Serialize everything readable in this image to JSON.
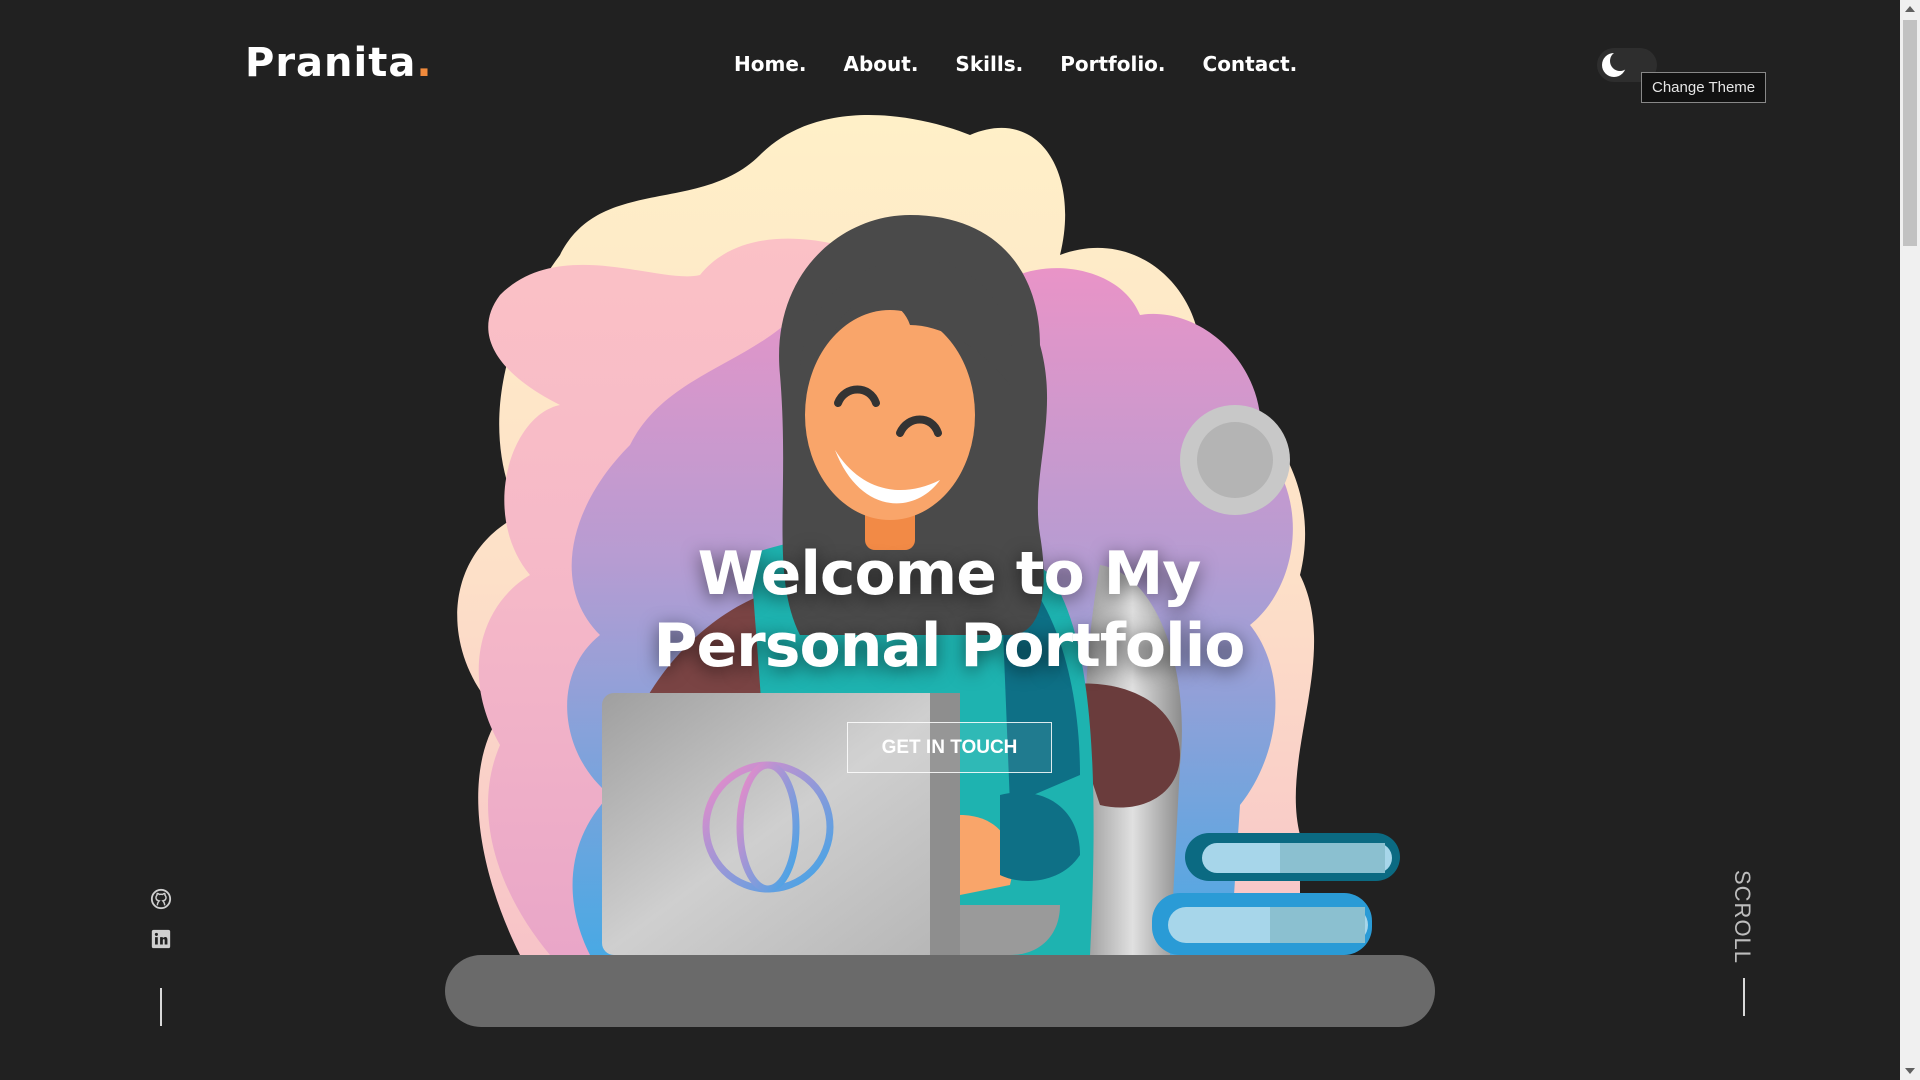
{
  "header": {
    "logo_text": "Pranita",
    "logo_dot": ".",
    "nav": [
      "Home.",
      "About.",
      "Skills.",
      "Portfolio.",
      "Contact."
    ],
    "theme_tooltip": "Change Theme"
  },
  "hero": {
    "title_line1": "Welcome to My",
    "title_line2": "Personal Portfolio",
    "cta_label": "GET IN TOUCH"
  },
  "social": {
    "icons": [
      "github-icon",
      "linkedin-icon"
    ]
  },
  "scroll": {
    "label": "SCROLL"
  },
  "colors": {
    "background": "#212121",
    "accent": "#f08a3c"
  }
}
